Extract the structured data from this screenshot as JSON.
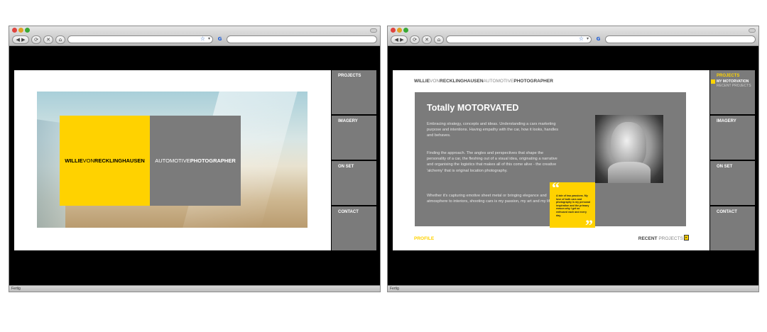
{
  "browser": {
    "status_text": "Fertig",
    "back_icon": "back-arrow-icon",
    "forward_icon": "forward-arrow-icon",
    "reload_glyph": "⟳",
    "stop_glyph": "✕",
    "home_glyph": "⌂",
    "star_glyph": "☆",
    "dropdown_glyph": "▾",
    "search_engine_glyph": "G"
  },
  "left_window": {
    "nav": [
      {
        "label": "PROJECTS"
      },
      {
        "label": "IMAGERY"
      },
      {
        "label": "ON SET"
      },
      {
        "label": "CONTACT"
      }
    ],
    "logo": {
      "part1": "WILLIE",
      "part2": "VON",
      "part3": "RECKLINGHAUSEN"
    },
    "tagline": {
      "part1": "AUTOMOTIVE",
      "part2": "PHOTOGRAPHER"
    }
  },
  "right_window": {
    "brand": {
      "part1": "WILLIE",
      "part2": "VON",
      "part3": "RECKLINGHAUSEN",
      "part4": "AUTOMOTIVE",
      "part5": "PHOTOGRAPHER"
    },
    "nav": [
      {
        "label": "PROJECTS",
        "active": true,
        "sub": [
          "MY MOTORVATION",
          "RECENT PROJECTS"
        ]
      },
      {
        "label": "IMAGERY"
      },
      {
        "label": "ON SET"
      },
      {
        "label": "CONTACT"
      }
    ],
    "title": "Totally MOTORVATED",
    "paragraphs": [
      "Embracing strategy, concepts and ideas. Understanding a cars marketing purpose and intentions. Having empathy with the car, how it looks, handles and behaves.",
      "Finding the approach. The angles and perspectives that shape the personality of a car, the fleshing out of a visual idea, originating a narrative and organising the logistics that makes all of this come alive - the creative 'alchemy' that is original location photography.",
      "Whether it's capturing emotive sheet metal or bringing elegance and atmosphere to interiors, shooting cars is my passion, my art and my life."
    ],
    "quote": "A tale of two passions. My love of both cars and photography is my personal inspiration and the primary reason why I get so enthused each and every day.",
    "quote_open": "“",
    "quote_close": "”",
    "profile_link": "PROFILE",
    "recent_link": {
      "part1": "RECENT",
      "part2": "PROJECTS"
    },
    "arrow_glyph": "▸"
  },
  "colors": {
    "accent_yellow": "#ffd200",
    "panel_gray": "#7b7b7b"
  }
}
